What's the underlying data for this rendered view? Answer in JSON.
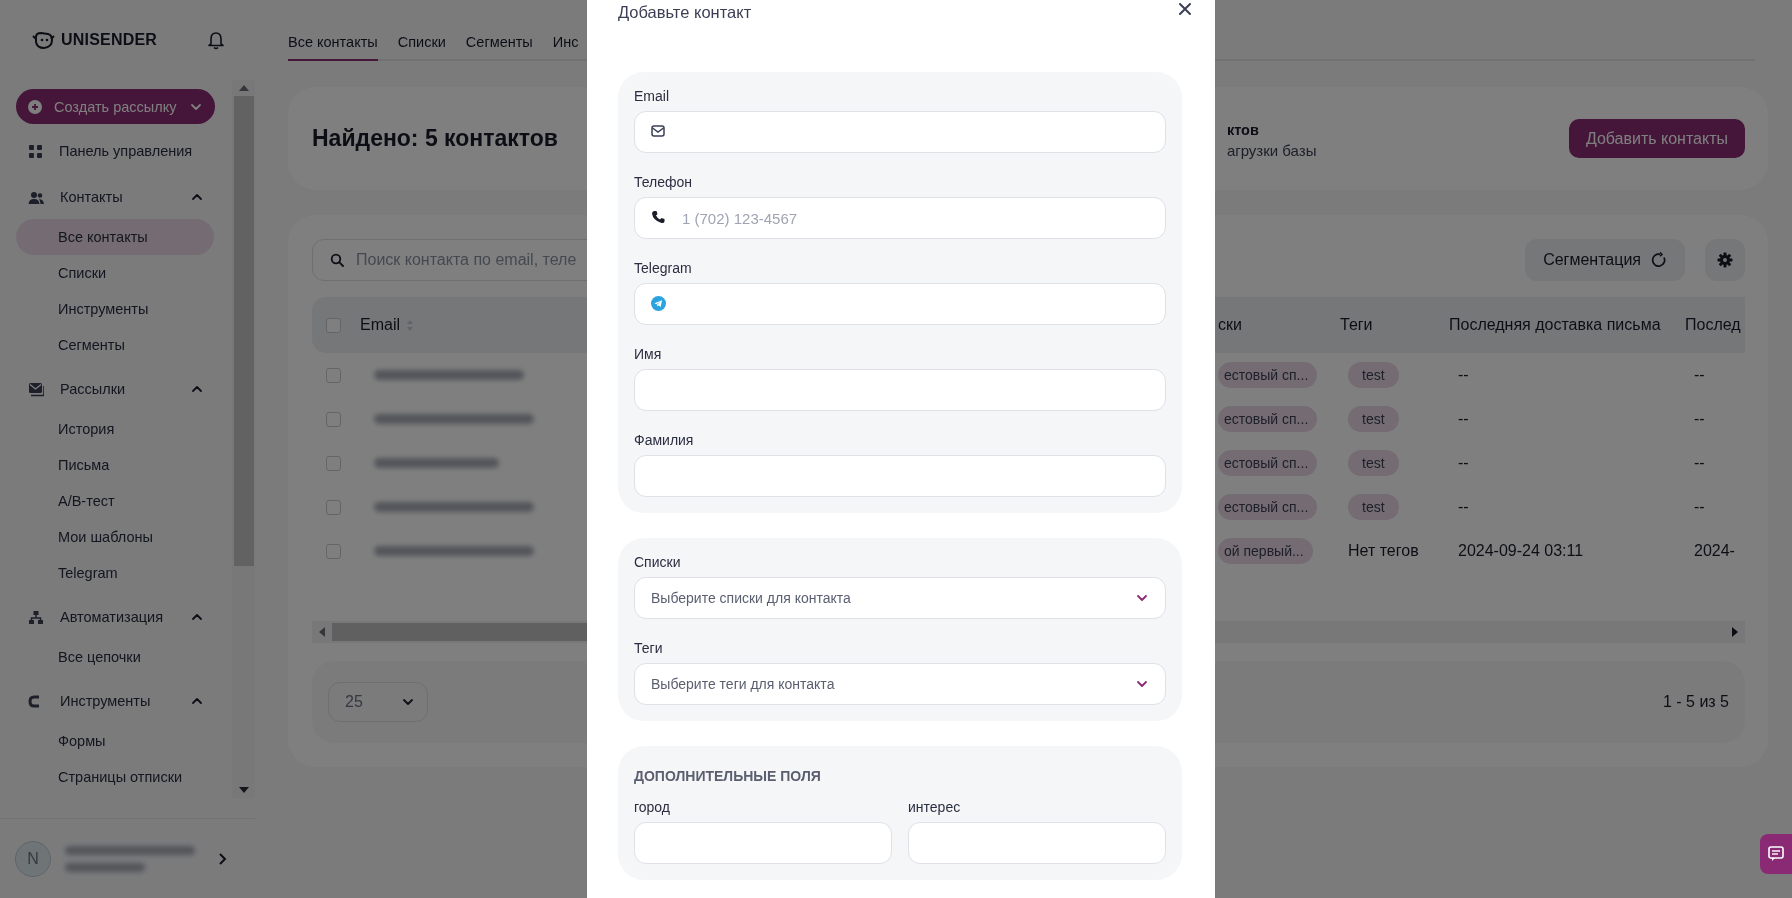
{
  "sidebar": {
    "logo": "UNISENDER",
    "create_button": "Создать рассылку",
    "nav": [
      {
        "label": "Панель управления"
      },
      {
        "label": "Контакты",
        "expanded": true,
        "children": [
          {
            "label": "Все контакты",
            "selected": true
          },
          {
            "label": "Списки",
            "selected": false
          },
          {
            "label": "Инструменты",
            "selected": false
          },
          {
            "label": "Сегменты",
            "selected": false
          }
        ]
      },
      {
        "label": "Рассылки",
        "expanded": true,
        "children": [
          {
            "label": "История",
            "selected": false
          },
          {
            "label": "Письма",
            "selected": false
          },
          {
            "label": "A/B-тест",
            "selected": false
          },
          {
            "label": "Мои шаблоны",
            "selected": false
          },
          {
            "label": "Telegram",
            "selected": false
          }
        ]
      },
      {
        "label": "Автоматизация",
        "expanded": true,
        "children": [
          {
            "label": "Все цепочки",
            "selected": false
          }
        ]
      },
      {
        "label": "Инструменты",
        "expanded": true,
        "children": [
          {
            "label": "Формы",
            "selected": false
          },
          {
            "label": "Страницы отписки",
            "selected": false
          }
        ]
      }
    ],
    "user": {
      "avatar": "N"
    }
  },
  "tabs": [
    {
      "label": "Все контакты",
      "selected": true
    },
    {
      "label": "Списки",
      "selected": false
    },
    {
      "label": "Сегменты",
      "selected": false
    },
    {
      "label": "Инс",
      "selected": false
    }
  ],
  "header": {
    "title": "Найдено: 5 контактов",
    "info_line_1": "ктов",
    "info_line_2": "агрузки базы",
    "button": "Добавить контакты"
  },
  "contacts": {
    "search_placeholder": "Поиск контакта по email, теле",
    "segment_button": "Сегментация",
    "all_checked": false,
    "columns": [
      "Email",
      "ски",
      "Теги",
      "Последняя доставка письма",
      "Послед"
    ],
    "rows": [
      {
        "checked": false,
        "lists": "естовый сп...",
        "tags": {
          "kind": "tag",
          "text": "test"
        },
        "last_delivery": "--",
        "column_5": "--"
      },
      {
        "checked": false,
        "lists": "естовый сп...",
        "tags": {
          "kind": "tag",
          "text": "test"
        },
        "last_delivery": "--",
        "column_5": "--"
      },
      {
        "checked": false,
        "lists": "естовый сп...",
        "tags": {
          "kind": "tag",
          "text": "test"
        },
        "last_delivery": "--",
        "column_5": "--"
      },
      {
        "checked": false,
        "lists": "естовый сп...",
        "tags": {
          "kind": "tag",
          "text": "test"
        },
        "last_delivery": "--",
        "column_5": "--"
      },
      {
        "checked": false,
        "lists": "ой первый...",
        "tags": {
          "kind": "plain",
          "text": "Нет тегов"
        },
        "last_delivery": "2024-09-24 03:11",
        "column_5": "2024-"
      }
    ],
    "page_size": "25",
    "range": "1 - 5 из 5"
  },
  "modal": {
    "title": "Добавьте контакт",
    "sections": [
      {
        "kind": "stack",
        "fields": [
          {
            "label": "Email",
            "kind": "email"
          },
          {
            "label": "Телефон",
            "kind": "phone",
            "placeholder": "1 (702) 123-4567"
          },
          {
            "label": "Telegram",
            "kind": "telegram"
          },
          {
            "label": "Имя",
            "kind": "text"
          },
          {
            "label": "Фамилия",
            "kind": "text"
          }
        ]
      },
      {
        "kind": "stack",
        "fields": [
          {
            "label": "Списки",
            "kind": "select",
            "placeholder": "Выберите списки для контакта"
          },
          {
            "label": "Теги",
            "kind": "select",
            "placeholder": "Выберите теги для контакта"
          }
        ]
      },
      {
        "kind": "two-column",
        "heading": "ДОПОЛНИТЕЛЬНЫЕ ПОЛЯ",
        "fields": [
          {
            "label": "город",
            "kind": "text"
          },
          {
            "label": "интерес",
            "kind": "text"
          }
        ]
      }
    ]
  }
}
